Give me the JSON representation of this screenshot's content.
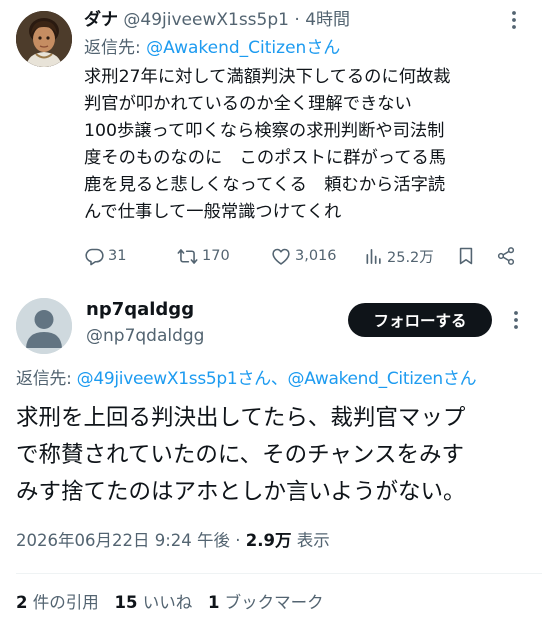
{
  "reply_tweet": {
    "display_name": "ダナ",
    "handle": "@49jiveewX1ss5p1",
    "separator": "·",
    "time": "4時間",
    "reply_prefix": "返信先: ",
    "reply_to": "@Awakend_Citizen",
    "reply_suffix": "さん",
    "text": "求刑27年に対して満額判決下してるのに何故裁\n判官が叩かれているのか全く理解できない\n100歩譲って叩くなら検察の求刑判断や司法制\n度そのものなのに　このポストに群がってる馬\n鹿を見ると悲しくなってくる　頼むから活字読\nんで仕事して一般常識つけてくれ",
    "replies": "31",
    "retweets": "170",
    "likes": "3,016",
    "views": "25.2万"
  },
  "main_tweet": {
    "display_name": "np7qaldgg",
    "handle": "@np7qdaldgg",
    "follow_label": "フォローする",
    "reply_prefix": "返信先: ",
    "reply_to_1": "@49jiveewX1ss5p1さん",
    "reply_sep": "、",
    "reply_to_2": "@Awakend_Citizenさん",
    "text": "求刑を上回る判決出してたら、裁判官マップ\nで称賛されていたのに、そのチャンスをみす\nみす捨てたのはアホとしか言いようがない。",
    "timestamp": "2026年06月22日 9:24 午後",
    "dot": "·",
    "views_count": "2.9万",
    "views_label": " 表示",
    "quotes_count": "2",
    "quotes_label": " 件の引用",
    "likes_count": "15",
    "likes_label": " いいね",
    "bookmarks_count": "1",
    "bookmarks_label": " ブックマーク"
  },
  "colors": {
    "link": "#1d9bf0",
    "secondary_text": "#536471",
    "primary_text": "#0f1419",
    "follow_bg": "#0f1419"
  }
}
